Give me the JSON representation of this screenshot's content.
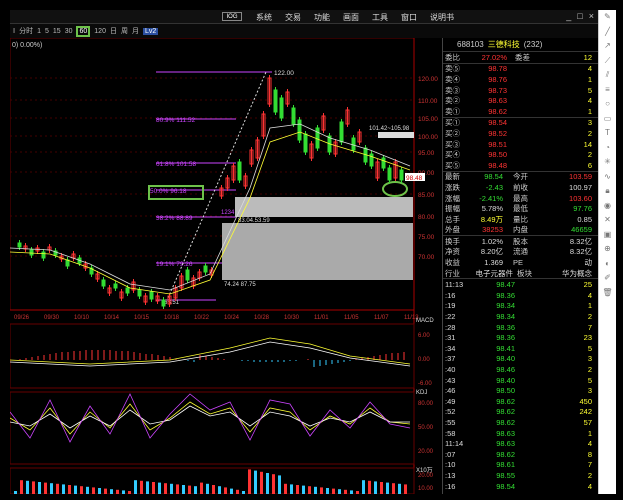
{
  "menu": {
    "items": [
      "系统",
      "交易",
      "功能",
      "画面",
      "工具",
      "窗口",
      "说明书"
    ],
    "logo_text": "IOG",
    "controls": [
      "_",
      "□",
      "×"
    ]
  },
  "toolbar": {
    "items": [
      "Ⅰ",
      "分时",
      "1",
      "5",
      "15",
      "30"
    ],
    "selected": "60",
    "after": [
      "120",
      "日",
      "周",
      "月"
    ],
    "blue_btn": "Lv2"
  },
  "chart": {
    "pct_label": "0) 0.00%)",
    "price_axis": [
      "120.00",
      "110.00",
      "105.00",
      "100.00",
      "95.00",
      "90.00",
      "85.00",
      "80.00",
      "75.00",
      "70.00"
    ],
    "fib_labels": [
      "80.9% 111.52",
      "61.8% 101.58",
      "50.0% 96.18",
      "38.2% 88.89",
      "19.1% 79.26"
    ],
    "label_high": "122.00",
    "label_low": "68.51",
    "label_box1": "101.42~105.98",
    "label_box2": "83.04.53.59",
    "label_box3": "74.24 87.75",
    "label_1234": "1234",
    "price_tag": "98.48",
    "x_dates": [
      "09/26",
      "09/30",
      "10/10",
      "10/14",
      "10/15",
      "10/18",
      "10/22",
      "10/24",
      "10/28",
      "10/30",
      "11/01",
      "11/05",
      "11/07",
      "11/13"
    ],
    "panel1_labels": [
      "6.00",
      "0.00",
      "-6.00"
    ],
    "panel2_labels": [
      "80.00",
      "50.00",
      "20.00"
    ],
    "panel3_labels": [
      "20.00",
      "10.00"
    ],
    "panel3_unit": "X10万",
    "panel1_tag": "MACD",
    "panel2_tag": "KDJ"
  },
  "quote": {
    "code": "688103",
    "name": "三德科技",
    "count": "(232)",
    "weibi_label": "委比",
    "weibi_value": "27.02%",
    "weicha_label": "委差",
    "weicha_value": "12",
    "asks": [
      {
        "label": "卖⑤",
        "price": "98.78",
        "vol": "4"
      },
      {
        "label": "卖④",
        "price": "98.76",
        "vol": "1"
      },
      {
        "label": "卖③",
        "price": "98.73",
        "vol": "5"
      },
      {
        "label": "卖②",
        "price": "98.63",
        "vol": "4"
      },
      {
        "label": "卖①",
        "price": "98.62",
        "vol": "1"
      }
    ],
    "bids": [
      {
        "label": "买①",
        "price": "98.54",
        "vol": "3"
      },
      {
        "label": "买②",
        "price": "98.52",
        "vol": "2"
      },
      {
        "label": "买③",
        "price": "98.51",
        "vol": "14"
      },
      {
        "label": "买④",
        "price": "98.50",
        "vol": "2"
      },
      {
        "label": "买⑤",
        "price": "98.48",
        "vol": "6"
      }
    ],
    "info": [
      {
        "l1": "最新",
        "v1": "98.54",
        "c1": "green",
        "l2": "今开",
        "v2": "103.59",
        "c2": "red"
      },
      {
        "l1": "涨跌",
        "v1": "-2.43",
        "c1": "green",
        "l2": "前收",
        "v2": "100.97",
        "c2": "white"
      },
      {
        "l1": "涨幅",
        "v1": "-2.41%",
        "c1": "green",
        "l2": "最高",
        "v2": "103.60",
        "c2": "red"
      },
      {
        "l1": "振幅",
        "v1": "5.78%",
        "c1": "white",
        "l2": "最低",
        "v2": "97.76",
        "c2": "green"
      },
      {
        "l1": "总手",
        "v1": "8.49万",
        "c1": "yel",
        "l2": "量比",
        "v2": "0.85",
        "c2": "white"
      },
      {
        "l1": "外盘",
        "v1": "38253",
        "c1": "red",
        "l2": "内盘",
        "v2": "46659",
        "c2": "green"
      }
    ],
    "info2": [
      {
        "l1": "换手",
        "v1": "1.02%",
        "l2": "股本",
        "v2": "8.32亿"
      },
      {
        "l1": "净资",
        "v1": "8.20亿",
        "l2": "流通",
        "v2": "8.32亿"
      },
      {
        "l1": "收益",
        "v1": "1.369",
        "l2": "PE",
        "v2": "动"
      }
    ],
    "industry": {
      "l1": "行业",
      "v1": "电子元器件",
      "l2": "板块",
      "v2": "华为概念"
    }
  },
  "ticks": [
    {
      "t": "11:13",
      "p": "98.47",
      "v": "25"
    },
    {
      "t": ":16",
      "p": "98.36",
      "v": "4"
    },
    {
      "t": ":19",
      "p": "98.34",
      "v": "1"
    },
    {
      "t": ":22",
      "p": "98.34",
      "v": "2"
    },
    {
      "t": ":28",
      "p": "98.36",
      "v": "7"
    },
    {
      "t": ":31",
      "p": "98.36",
      "v": "23"
    },
    {
      "t": ":34",
      "p": "98.41",
      "v": "5"
    },
    {
      "t": ":37",
      "p": "98.40",
      "v": "3"
    },
    {
      "t": ":40",
      "p": "98.46",
      "v": "2"
    },
    {
      "t": ":43",
      "p": "98.40",
      "v": "5"
    },
    {
      "t": ":46",
      "p": "98.50",
      "v": "3"
    },
    {
      "t": ":49",
      "p": "98.62",
      "v": "450"
    },
    {
      "t": ":52",
      "p": "98.62",
      "v": "242"
    },
    {
      "t": ":55",
      "p": "98.62",
      "v": "57"
    },
    {
      "t": ":58",
      "p": "98.63",
      "v": "1"
    },
    {
      "t": "11:14",
      "p": "98.63",
      "v": "4"
    },
    {
      "t": ":07",
      "p": "98.62",
      "v": "8"
    },
    {
      "t": ":10",
      "p": "98.61",
      "v": "7"
    },
    {
      "t": ":13",
      "p": "98.55",
      "v": "2"
    },
    {
      "t": ":16",
      "p": "98.54",
      "v": "4"
    }
  ],
  "sidebar_icons": [
    "pen-icon",
    "line-icon",
    "arrow-icon",
    "ray-icon",
    "channel-icon",
    "fib-icon",
    "circle-icon",
    "rect-icon",
    "text-icon",
    "cycle-icon",
    "gann-icon",
    "wave-icon",
    "lock-icon",
    "eye-icon",
    "delete-icon",
    "save-icon",
    "zoom-icon",
    "color-icon",
    "brush-icon",
    "trash-icon"
  ],
  "colors": {
    "up": "#ff3333",
    "down": "#33dd33",
    "fib": "#cc44ff",
    "highlight": "#6ec24a",
    "axis": "#cc2222"
  }
}
